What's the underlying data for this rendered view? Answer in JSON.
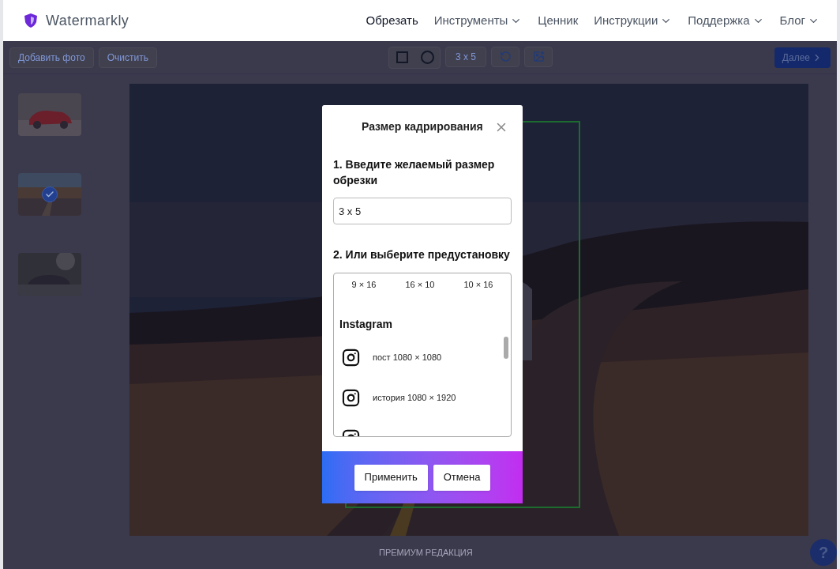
{
  "header": {
    "logo": "Watermarkly",
    "nav": [
      {
        "label": "Обрезать",
        "dropdown": false,
        "selected": true
      },
      {
        "label": "Инструменты",
        "dropdown": true,
        "selected": false
      },
      {
        "label": "Ценник",
        "dropdown": false,
        "selected": false
      },
      {
        "label": "Инструкции",
        "dropdown": true,
        "selected": false
      },
      {
        "label": "Поддержка",
        "dropdown": true,
        "selected": false
      },
      {
        "label": "Блог",
        "dropdown": true,
        "selected": false
      }
    ]
  },
  "toolbar": {
    "left_buttons": [
      "Добавить фото",
      "Очистить"
    ],
    "shapes": [
      {
        "kind": "square"
      },
      {
        "kind": "circle"
      }
    ],
    "ratio": "3 x 5",
    "next": "Далее"
  },
  "thumbnails": [
    {
      "selected": false
    },
    {
      "selected": true
    },
    {
      "selected": false
    }
  ],
  "footer": {
    "text": "ПРЕМИУМ РЕДАКЦИЯ",
    "help": "?"
  },
  "modal": {
    "title": "Размер кадрирования",
    "step1": "1. Введите желаемый размер обрезки",
    "size_value": "3 x 5",
    "step2": "2. Или выберите предустановку",
    "ratios": [
      "9 × 16",
      "16 × 10",
      "10 × 16"
    ],
    "group": "Instagram",
    "items": [
      {
        "kind": "preset",
        "label": "пост 1080 × 1080"
      },
      {
        "kind": "preset",
        "label": "история 1080 × 1920"
      },
      {
        "kind": "cut-off"
      }
    ],
    "buttons": [
      "Применить",
      "Отмена"
    ]
  }
}
